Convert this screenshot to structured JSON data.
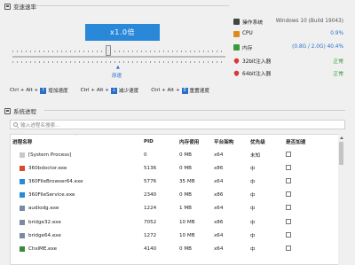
{
  "speed_panel": {
    "title": "变速速率",
    "multiplier_display": "x1.0倍",
    "slider_label": "原速",
    "hotkeys": [
      {
        "prefix": "Ctrl + Alt +",
        "key": "↑",
        "label": "增加速度"
      },
      {
        "prefix": "Ctrl + Alt +",
        "key": "↓",
        "label": "减少速度"
      },
      {
        "prefix": "Ctrl + Alt +",
        "key": "0",
        "label": "重置速度"
      }
    ]
  },
  "system_info": {
    "rows": [
      {
        "label": "操作系统",
        "value": "Windows 10 (Build 19043)",
        "icon": "os-icon",
        "value_color": "#555555"
      },
      {
        "label": "CPU",
        "value": "0.9%",
        "icon": "cpu-icon",
        "value_color": "#2a6fc9"
      },
      {
        "label": "内存",
        "value": "(0.8G / 2.0G) 40.4%",
        "icon": "memory-icon",
        "value_color": "#2a6fc9"
      },
      {
        "label": "32bit注入器",
        "value": "正常",
        "icon": "heart-icon",
        "value_color": "#2e9a2e"
      },
      {
        "label": "64bit注入器",
        "value": "正常",
        "icon": "heart-icon",
        "value_color": "#2e9a2e"
      }
    ]
  },
  "process_panel": {
    "title": "系统进程",
    "search_placeholder": "输入进程名搜索...",
    "columns": [
      "进程名称",
      "PID",
      "内存使用",
      "平台架构",
      "优先级",
      "是否加速"
    ],
    "rows": [
      {
        "name": "[System Process]",
        "pid": "0",
        "mem": "0 MB",
        "arch": "x64",
        "priority": "未知",
        "accelerated": false,
        "icon_color": "#c8c8c8"
      },
      {
        "name": "360bdoctor.exe",
        "pid": "5136",
        "mem": "0 MB",
        "arch": "x86",
        "priority": "中",
        "accelerated": false,
        "icon_color": "#d94a2b"
      },
      {
        "name": "360FileBrowser64.exe",
        "pid": "5776",
        "mem": "35 MB",
        "arch": "x64",
        "priority": "中",
        "accelerated": false,
        "icon_color": "#2a8ad8"
      },
      {
        "name": "360FileService.exe",
        "pid": "2340",
        "mem": "0 MB",
        "arch": "x86",
        "priority": "中",
        "accelerated": false,
        "icon_color": "#2a8ad8"
      },
      {
        "name": "audiodg.exe",
        "pid": "1224",
        "mem": "1 MB",
        "arch": "x64",
        "priority": "中",
        "accelerated": false,
        "icon_color": "#7a8aa0"
      },
      {
        "name": "bridge32.exe",
        "pid": "7052",
        "mem": "10 MB",
        "arch": "x86",
        "priority": "中",
        "accelerated": false,
        "icon_color": "#7a8aa0"
      },
      {
        "name": "bridge64.exe",
        "pid": "1272",
        "mem": "10 MB",
        "arch": "x64",
        "priority": "中",
        "accelerated": false,
        "icon_color": "#7a8aa0"
      },
      {
        "name": "ChsIME.exe",
        "pid": "4140",
        "mem": "0 MB",
        "arch": "x64",
        "priority": "中",
        "accelerated": false,
        "icon_color": "#3a8a3a"
      }
    ]
  }
}
